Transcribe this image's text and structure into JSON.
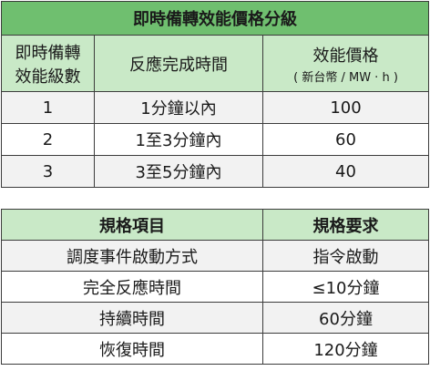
{
  "table1": {
    "title": "即時備轉效能價格分級",
    "headers": {
      "level_line1": "即時備轉",
      "level_line2": "效能級數",
      "response": "反應完成時間",
      "price": "效能價格",
      "price_unit": "( 新台幣 / MW · h )"
    },
    "rows": [
      {
        "level": "1",
        "response": "1分鐘以內",
        "price": "100"
      },
      {
        "level": "2",
        "response": "1至3分鐘內",
        "price": "60"
      },
      {
        "level": "3",
        "response": "3至5分鐘內",
        "price": "40"
      }
    ]
  },
  "table2": {
    "headers": {
      "item": "規格項目",
      "requirement": "規格要求"
    },
    "rows": [
      {
        "item": "調度事件啟動方式",
        "requirement": "指令啟動"
      },
      {
        "item": "完全反應時間",
        "requirement": "≤10分鐘"
      },
      {
        "item": "持續時間",
        "requirement": "60分鐘"
      },
      {
        "item": "恢復時間",
        "requirement": "120分鐘"
      }
    ]
  },
  "colors": {
    "title_bg": "#6fbf6f",
    "header_bg": "#c9e9c7",
    "border": "#3c3c3c"
  }
}
